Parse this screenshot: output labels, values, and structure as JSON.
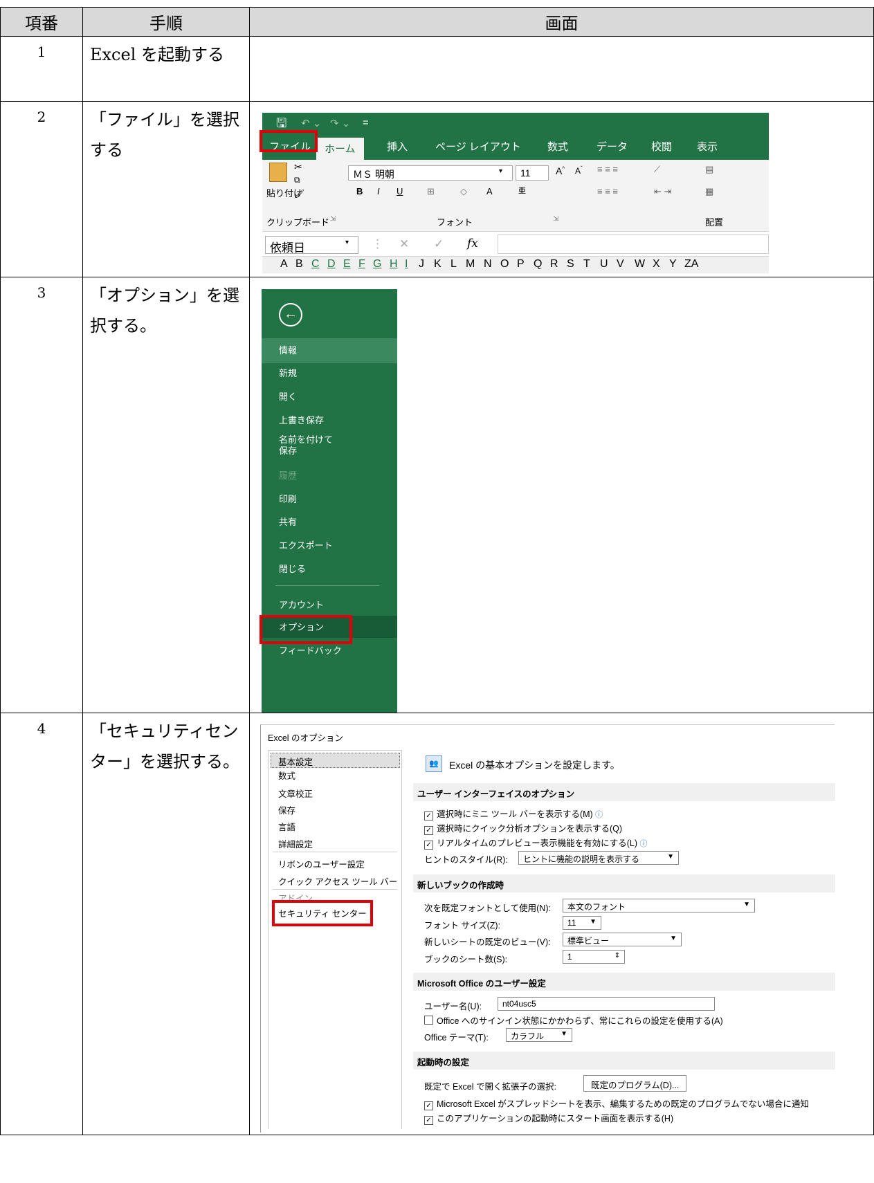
{
  "table": {
    "headers": [
      "項番",
      "手順",
      "画面"
    ],
    "rows": [
      {
        "no": "1",
        "step": "Excel を起動する"
      },
      {
        "no": "2",
        "step": "「ファイル」を選択する"
      },
      {
        "no": "3",
        "step": "「オプション」を選択する。"
      },
      {
        "no": "4",
        "step": "「セキュリティセンター」を選択する。"
      }
    ]
  },
  "ribbon": {
    "qat": [
      "🖫",
      "↶ ⌄",
      "↷ ⌄",
      "="
    ],
    "tabs": [
      "ファイル",
      "ホーム",
      "挿入",
      "ページ レイアウト",
      "数式",
      "データ",
      "校閲",
      "表示"
    ],
    "active_tab": "ホーム",
    "paste_label": "貼り付け",
    "clipboard_group": "クリップボード",
    "font_group": "フォント",
    "align_group": "配置",
    "font_name": "ＭＳ 明朝",
    "font_size": "11",
    "name_box": "依頼日",
    "fx": "fx",
    "columns": [
      "A",
      "B",
      "C",
      "D",
      "E",
      "F",
      "G",
      "H",
      "I",
      "J",
      "K",
      "L",
      "M",
      "N",
      "O",
      "P",
      "Q",
      "R",
      "S",
      "T",
      "U",
      "V",
      "W",
      "X",
      "Y",
      "ZA"
    ]
  },
  "backstage": {
    "back_icon": "back-arrow-icon",
    "items": [
      "情報",
      "新規",
      "開く",
      "上書き保存",
      "名前を付けて保存",
      "履歴",
      "印刷",
      "共有",
      "エクスポート",
      "閉じる",
      "アカウント",
      "オプション",
      "フィードバック"
    ]
  },
  "options": {
    "title": "Excel のオプション",
    "side": [
      "基本設定",
      "数式",
      "文章校正",
      "保存",
      "言語",
      "詳細設定",
      "リボンのユーザー設定",
      "クイック アクセス ツール バー",
      "アドイン",
      "セキュリティ センター"
    ],
    "intro": "Excel の基本オプションを設定します。",
    "sec_ui": "ユーザー インターフェイスのオプション",
    "ui_mini": "選択時にミニ ツール バーを表示する(M)",
    "ui_quick": "選択時にクイック分析オプションを表示する(Q)",
    "ui_live": "リアルタイムのプレビュー表示機能を有効にする(L)",
    "tip_label": "ヒントのスタイル(R):",
    "tip_value": "ヒントに機能の説明を表示する",
    "sec_new": "新しいブックの作成時",
    "font_label": "次を既定フォントとして使用(N):",
    "font_value": "本文のフォント",
    "size_label": "フォント サイズ(Z):",
    "size_value": "11",
    "view_label": "新しいシートの既定のビュー(V):",
    "view_value": "標準ビュー",
    "sheets_label": "ブックのシート数(S):",
    "sheets_value": "1",
    "sec_office": "Microsoft Office のユーザー設定",
    "user_label": "ユーザー名(U):",
    "user_value": "nt04usc5",
    "signin": "Office へのサインイン状態にかかわらず、常にこれらの設定を使用する(A)",
    "theme_label": "Office テーマ(T):",
    "theme_value": "カラフル",
    "sec_start": "起動時の設定",
    "ext_label": "既定で Excel で開く拡張子の選択:",
    "ext_button": "既定のプログラム(D)...",
    "notify": "Microsoft Excel がスプレッドシートを表示、編集するための既定のプログラムでない場合に通知",
    "startscreen": "このアプリケーションの起動時にスタート画面を表示する(H)"
  }
}
